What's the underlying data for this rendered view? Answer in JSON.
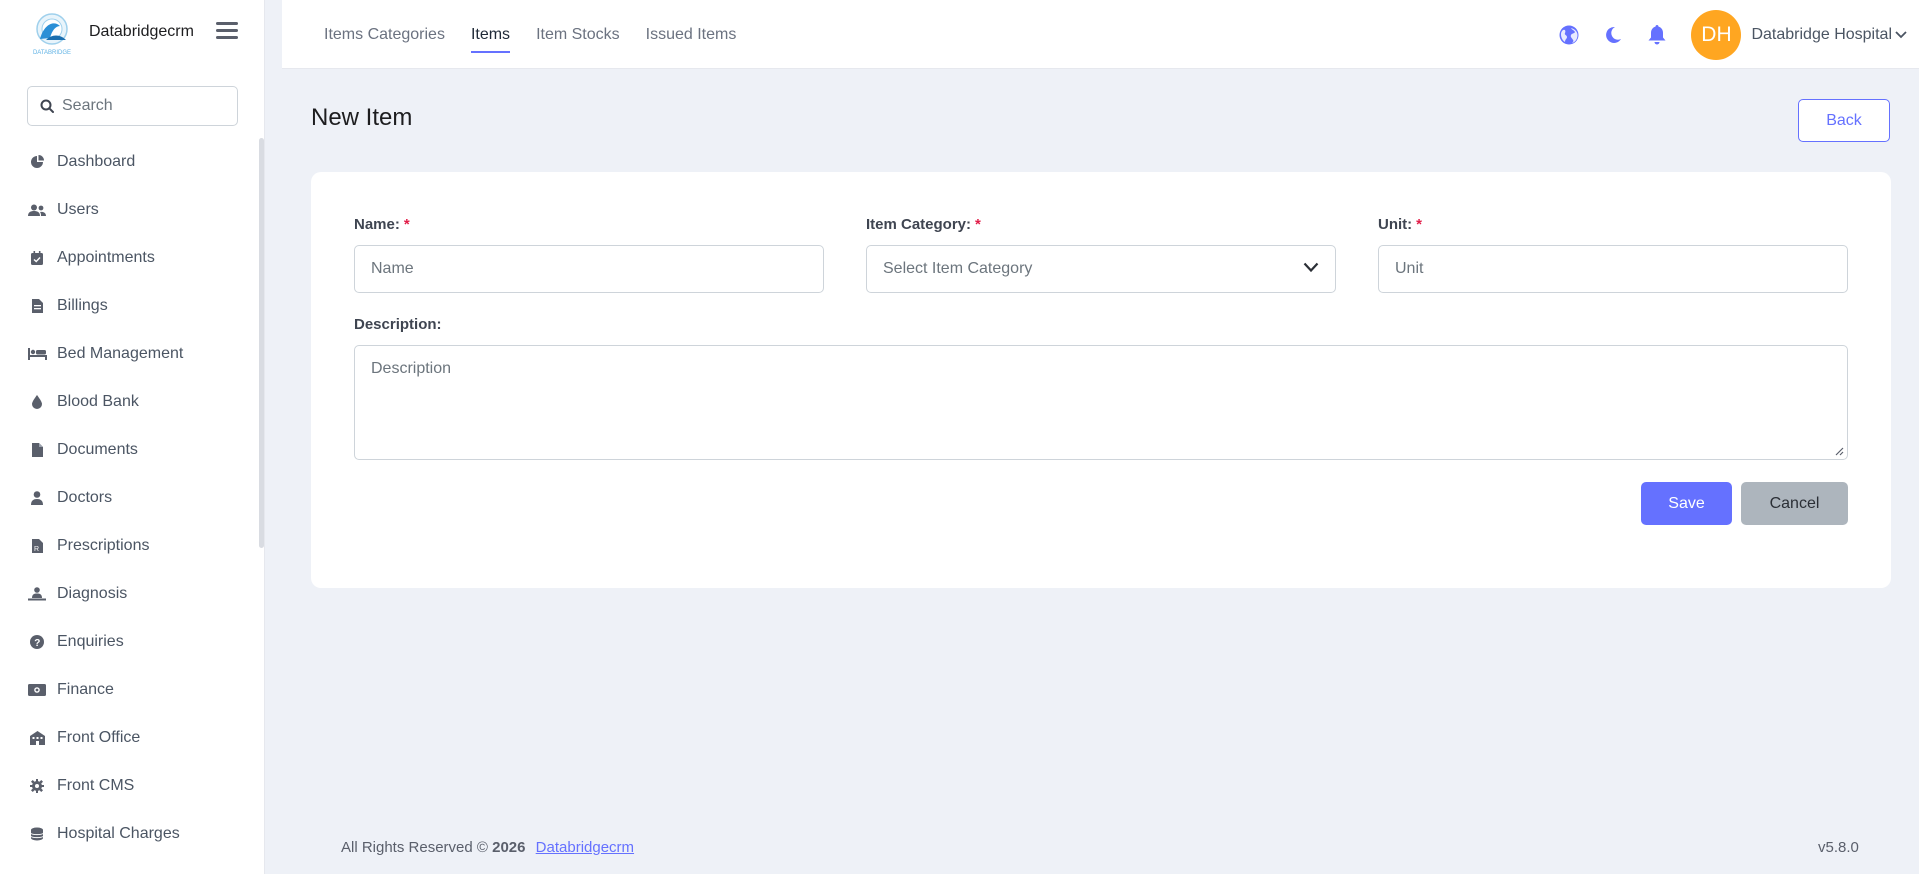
{
  "brand": {
    "name": "Databridgecrm",
    "logo_text": "DATABRIDGE"
  },
  "search": {
    "placeholder": "Search"
  },
  "sidebar": {
    "items": [
      {
        "label": "Dashboard",
        "icon": "chart-pie-icon"
      },
      {
        "label": "Users",
        "icon": "users-icon"
      },
      {
        "label": "Appointments",
        "icon": "calendar-check-icon"
      },
      {
        "label": "Billings",
        "icon": "invoice-icon"
      },
      {
        "label": "Bed Management",
        "icon": "bed-icon"
      },
      {
        "label": "Blood Bank",
        "icon": "droplet-icon"
      },
      {
        "label": "Documents",
        "icon": "file-icon"
      },
      {
        "label": "Doctors",
        "icon": "user-doctor-icon"
      },
      {
        "label": "Prescriptions",
        "icon": "prescription-icon"
      },
      {
        "label": "Diagnosis",
        "icon": "person-diagnosis-icon"
      },
      {
        "label": "Enquiries",
        "icon": "question-circle-icon"
      },
      {
        "label": "Finance",
        "icon": "money-bill-icon"
      },
      {
        "label": "Front Office",
        "icon": "building-icon"
      },
      {
        "label": "Front CMS",
        "icon": "gear-icon"
      },
      {
        "label": "Hospital Charges",
        "icon": "coins-icon"
      }
    ]
  },
  "header": {
    "tabs": [
      {
        "label": "Items Categories",
        "active": false
      },
      {
        "label": "Items",
        "active": true
      },
      {
        "label": "Item Stocks",
        "active": false
      },
      {
        "label": "Issued Items",
        "active": false
      }
    ],
    "icons": [
      "globe-icon",
      "moon-icon",
      "bell-icon"
    ],
    "avatar_initials": "DH",
    "user_name": "Databridge Hospital"
  },
  "page": {
    "title": "New Item",
    "back_label": "Back"
  },
  "form": {
    "name": {
      "label": "Name:",
      "required_mark": "*",
      "placeholder": "Name",
      "value": ""
    },
    "category": {
      "label": "Item Category:",
      "required_mark": "*",
      "selected": "Select Item Category"
    },
    "unit": {
      "label": "Unit:",
      "required_mark": "*",
      "placeholder": "Unit",
      "value": ""
    },
    "description": {
      "label": "Description:",
      "placeholder": "Description",
      "value": ""
    },
    "save_label": "Save",
    "cancel_label": "Cancel"
  },
  "footer": {
    "rights_text": "All Rights Reserved ©",
    "year": "2026",
    "link_text": "Databridgecrm",
    "version": "v5.8.0"
  },
  "colors": {
    "accent": "#6571ff",
    "avatar": "#ffa621",
    "required": "#e11d48",
    "cancel_button": "#adb5bd",
    "page_background": "#eef1f7"
  }
}
